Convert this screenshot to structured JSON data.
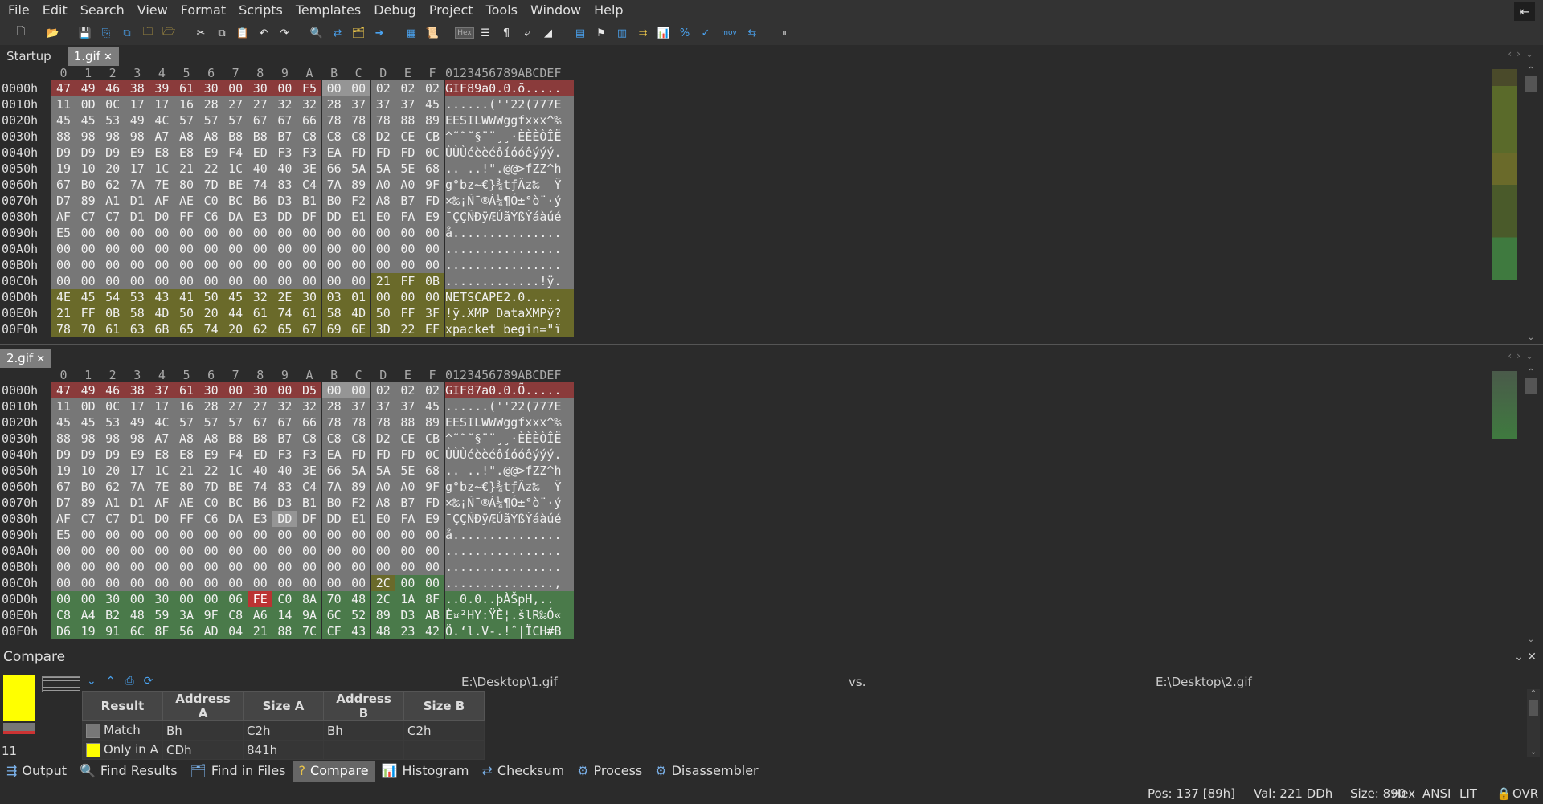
{
  "menu": [
    "File",
    "Edit",
    "Search",
    "View",
    "Format",
    "Scripts",
    "Templates",
    "Debug",
    "Project",
    "Tools",
    "Window",
    "Help"
  ],
  "tabs_top": {
    "startup": "Startup",
    "file1": "1.gif",
    "file2": "2.gif"
  },
  "hexbtn": "Hex",
  "movbtn": "mov",
  "col_headers": [
    "0",
    "1",
    "2",
    "3",
    "4",
    "5",
    "6",
    "7",
    "8",
    "9",
    "A",
    "B",
    "C",
    "D",
    "E",
    "F"
  ],
  "ascii_header": "0123456789ABCDEF",
  "panel1": {
    "rows": [
      {
        "addr": "0000h",
        "bytes": [
          "47",
          "49",
          "46",
          "38",
          "39",
          "61",
          "30",
          "00",
          "30",
          "00",
          "F5",
          "00",
          "00",
          "02",
          "02",
          "02"
        ],
        "ascii": "GIF89a0.0.õ....."
      },
      {
        "addr": "0010h",
        "bytes": [
          "11",
          "0D",
          "0C",
          "17",
          "17",
          "16",
          "28",
          "27",
          "27",
          "32",
          "32",
          "28",
          "37",
          "37",
          "37",
          "45"
        ],
        "ascii": "......(''22(777E"
      },
      {
        "addr": "0020h",
        "bytes": [
          "45",
          "45",
          "53",
          "49",
          "4C",
          "57",
          "57",
          "57",
          "67",
          "67",
          "66",
          "78",
          "78",
          "78",
          "88",
          "89"
        ],
        "ascii": "EESILWWWggfxxx^‰"
      },
      {
        "addr": "0030h",
        "bytes": [
          "88",
          "98",
          "98",
          "98",
          "A7",
          "A8",
          "A8",
          "B8",
          "B8",
          "B7",
          "C8",
          "C8",
          "C8",
          "D2",
          "CE",
          "CB"
        ],
        "ascii": "^˜˜˜§¨¨¸¸·ÈÈÈÒÎË"
      },
      {
        "addr": "0040h",
        "bytes": [
          "D9",
          "D9",
          "D9",
          "E9",
          "E8",
          "E8",
          "E9",
          "F4",
          "ED",
          "F3",
          "F3",
          "EA",
          "FD",
          "FD",
          "FD",
          "0C"
        ],
        "ascii": "ÙÙÙéèèéôíóóêýýý."
      },
      {
        "addr": "0050h",
        "bytes": [
          "19",
          "10",
          "20",
          "17",
          "1C",
          "21",
          "22",
          "1C",
          "40",
          "40",
          "3E",
          "66",
          "5A",
          "5A",
          "5E",
          "68"
        ],
        "ascii": ".. ..!\".@@>fZZ^h"
      },
      {
        "addr": "0060h",
        "bytes": [
          "67",
          "B0",
          "62",
          "7A",
          "7E",
          "80",
          "7D",
          "BE",
          "74",
          "83",
          "C4",
          "7A",
          "89",
          "A0",
          "A0",
          "9F"
        ],
        "ascii": "g°bz~€}¾tƒÄz‰  Ÿ"
      },
      {
        "addr": "0070h",
        "bytes": [
          "D7",
          "89",
          "A1",
          "D1",
          "AF",
          "AE",
          "C0",
          "BC",
          "B6",
          "D3",
          "B1",
          "B0",
          "F2",
          "A8",
          "B7",
          "FD"
        ],
        "ascii": "×‰¡Ñ¯®À¼¶Ó±°ò¨·ý"
      },
      {
        "addr": "0080h",
        "bytes": [
          "AF",
          "C7",
          "C7",
          "D1",
          "D0",
          "FF",
          "C6",
          "DA",
          "E3",
          "DD",
          "DF",
          "DD",
          "E1",
          "E0",
          "FA",
          "E9"
        ],
        "ascii": "¯ÇÇÑÐÿÆÚãÝßÝáàúé"
      },
      {
        "addr": "0090h",
        "bytes": [
          "E5",
          "00",
          "00",
          "00",
          "00",
          "00",
          "00",
          "00",
          "00",
          "00",
          "00",
          "00",
          "00",
          "00",
          "00",
          "00"
        ],
        "ascii": "å..............."
      },
      {
        "addr": "00A0h",
        "bytes": [
          "00",
          "00",
          "00",
          "00",
          "00",
          "00",
          "00",
          "00",
          "00",
          "00",
          "00",
          "00",
          "00",
          "00",
          "00",
          "00"
        ],
        "ascii": "................"
      },
      {
        "addr": "00B0h",
        "bytes": [
          "00",
          "00",
          "00",
          "00",
          "00",
          "00",
          "00",
          "00",
          "00",
          "00",
          "00",
          "00",
          "00",
          "00",
          "00",
          "00"
        ],
        "ascii": "................"
      },
      {
        "addr": "00C0h",
        "bytes": [
          "00",
          "00",
          "00",
          "00",
          "00",
          "00",
          "00",
          "00",
          "00",
          "00",
          "00",
          "00",
          "00",
          "21",
          "FF",
          "0B"
        ],
        "ascii": ".............!ÿ."
      },
      {
        "addr": "00D0h",
        "bytes": [
          "4E",
          "45",
          "54",
          "53",
          "43",
          "41",
          "50",
          "45",
          "32",
          "2E",
          "30",
          "03",
          "01",
          "00",
          "00",
          "00"
        ],
        "ascii": "NETSCAPE2.0....."
      },
      {
        "addr": "00E0h",
        "bytes": [
          "21",
          "FF",
          "0B",
          "58",
          "4D",
          "50",
          "20",
          "44",
          "61",
          "74",
          "61",
          "58",
          "4D",
          "50",
          "FF",
          "3F"
        ],
        "ascii": "!ÿ.XMP DataXMPÿ?"
      },
      {
        "addr": "00F0h",
        "bytes": [
          "78",
          "70",
          "61",
          "63",
          "6B",
          "65",
          "74",
          "20",
          "62",
          "65",
          "67",
          "69",
          "6E",
          "3D",
          "22",
          "EF"
        ],
        "ascii": "xpacket begin=\"ï"
      }
    ]
  },
  "panel2": {
    "rows": [
      {
        "addr": "0000h",
        "bytes": [
          "47",
          "49",
          "46",
          "38",
          "37",
          "61",
          "30",
          "00",
          "30",
          "00",
          "D5",
          "00",
          "00",
          "02",
          "02",
          "02"
        ],
        "ascii": "GIF87a0.0.Õ....."
      },
      {
        "addr": "0010h",
        "bytes": [
          "11",
          "0D",
          "0C",
          "17",
          "17",
          "16",
          "28",
          "27",
          "27",
          "32",
          "32",
          "28",
          "37",
          "37",
          "37",
          "45"
        ],
        "ascii": "......(''22(777E"
      },
      {
        "addr": "0020h",
        "bytes": [
          "45",
          "45",
          "53",
          "49",
          "4C",
          "57",
          "57",
          "57",
          "67",
          "67",
          "66",
          "78",
          "78",
          "78",
          "88",
          "89"
        ],
        "ascii": "EESILWWWggfxxx^‰"
      },
      {
        "addr": "0030h",
        "bytes": [
          "88",
          "98",
          "98",
          "98",
          "A7",
          "A8",
          "A8",
          "B8",
          "B8",
          "B7",
          "C8",
          "C8",
          "C8",
          "D2",
          "CE",
          "CB"
        ],
        "ascii": "^˜˜˜§¨¨¸¸·ÈÈÈÒÎË"
      },
      {
        "addr": "0040h",
        "bytes": [
          "D9",
          "D9",
          "D9",
          "E9",
          "E8",
          "E8",
          "E9",
          "F4",
          "ED",
          "F3",
          "F3",
          "EA",
          "FD",
          "FD",
          "FD",
          "0C"
        ],
        "ascii": "ÙÙÙéèèéôíóóêýýý."
      },
      {
        "addr": "0050h",
        "bytes": [
          "19",
          "10",
          "20",
          "17",
          "1C",
          "21",
          "22",
          "1C",
          "40",
          "40",
          "3E",
          "66",
          "5A",
          "5A",
          "5E",
          "68"
        ],
        "ascii": ".. ..!\".@@>fZZ^h"
      },
      {
        "addr": "0060h",
        "bytes": [
          "67",
          "B0",
          "62",
          "7A",
          "7E",
          "80",
          "7D",
          "BE",
          "74",
          "83",
          "C4",
          "7A",
          "89",
          "A0",
          "A0",
          "9F"
        ],
        "ascii": "g°bz~€}¾tƒÄz‰  Ÿ"
      },
      {
        "addr": "0070h",
        "bytes": [
          "D7",
          "89",
          "A1",
          "D1",
          "AF",
          "AE",
          "C0",
          "BC",
          "B6",
          "D3",
          "B1",
          "B0",
          "F2",
          "A8",
          "B7",
          "FD"
        ],
        "ascii": "×‰¡Ñ¯®À¼¶Ó±°ò¨·ý"
      },
      {
        "addr": "0080h",
        "bytes": [
          "AF",
          "C7",
          "C7",
          "D1",
          "D0",
          "FF",
          "C6",
          "DA",
          "E3",
          "DD",
          "DF",
          "DD",
          "E1",
          "E0",
          "FA",
          "E9"
        ],
        "ascii": "¯ÇÇÑÐÿÆÚãÝßÝáàúé"
      },
      {
        "addr": "0090h",
        "bytes": [
          "E5",
          "00",
          "00",
          "00",
          "00",
          "00",
          "00",
          "00",
          "00",
          "00",
          "00",
          "00",
          "00",
          "00",
          "00",
          "00"
        ],
        "ascii": "å..............."
      },
      {
        "addr": "00A0h",
        "bytes": [
          "00",
          "00",
          "00",
          "00",
          "00",
          "00",
          "00",
          "00",
          "00",
          "00",
          "00",
          "00",
          "00",
          "00",
          "00",
          "00"
        ],
        "ascii": "................"
      },
      {
        "addr": "00B0h",
        "bytes": [
          "00",
          "00",
          "00",
          "00",
          "00",
          "00",
          "00",
          "00",
          "00",
          "00",
          "00",
          "00",
          "00",
          "00",
          "00",
          "00"
        ],
        "ascii": "................"
      },
      {
        "addr": "00C0h",
        "bytes": [
          "00",
          "00",
          "00",
          "00",
          "00",
          "00",
          "00",
          "00",
          "00",
          "00",
          "00",
          "00",
          "00",
          "2C",
          "00",
          "00"
        ],
        "ascii": "...............,"
      },
      {
        "addr": "00D0h",
        "bytes": [
          "00",
          "00",
          "30",
          "00",
          "30",
          "00",
          "00",
          "06",
          "FE",
          "C0",
          "8A",
          "70",
          "48",
          "2C",
          "1A",
          "8F"
        ],
        "ascii": "..0.0..þÀŠpH,.."
      },
      {
        "addr": "00E0h",
        "bytes": [
          "C8",
          "A4",
          "B2",
          "48",
          "59",
          "3A",
          "9F",
          "C8",
          "A6",
          "14",
          "9A",
          "6C",
          "52",
          "89",
          "D3",
          "AB"
        ],
        "ascii": "È¤²HY:ŸÈ¦.šlR‰Ó«"
      },
      {
        "addr": "00F0h",
        "bytes": [
          "D6",
          "19",
          "91",
          "6C",
          "8F",
          "56",
          "AD",
          "04",
          "21",
          "88",
          "7C",
          "CF",
          "43",
          "48",
          "23",
          "42"
        ],
        "ascii": "Ö.‘l.V-.!ˆ|ÏCH#B"
      }
    ]
  },
  "compare": {
    "title": "Compare",
    "file_a": "E:\\Desktop\\1.gif",
    "vs": "vs.",
    "file_b": "E:\\Desktop\\2.gif",
    "count": "11",
    "columns": [
      "Result",
      "Address A",
      "Size A",
      "Address B",
      "Size B"
    ],
    "rows": [
      {
        "result": "Match",
        "addr_a": "Bh",
        "size_a": "C2h",
        "addr_b": "Bh",
        "size_b": "C2h",
        "color": "#777777"
      },
      {
        "result": "Only in A",
        "addr_a": "CDh",
        "size_a": "841h",
        "addr_b": "",
        "size_b": "",
        "color": "#ffff00"
      }
    ]
  },
  "bottom_tabs": [
    "Output",
    "Find Results",
    "Find in Files",
    "Compare",
    "Histogram",
    "Checksum",
    "Process",
    "Disassembler"
  ],
  "status": {
    "pos": "Pos: 137 [89h]",
    "val": "Val: 221 DDh",
    "size": "Size: 890",
    "hex": "Hex",
    "ansi": "ANSI",
    "lit": "LIT",
    "ovr": "OVR"
  }
}
